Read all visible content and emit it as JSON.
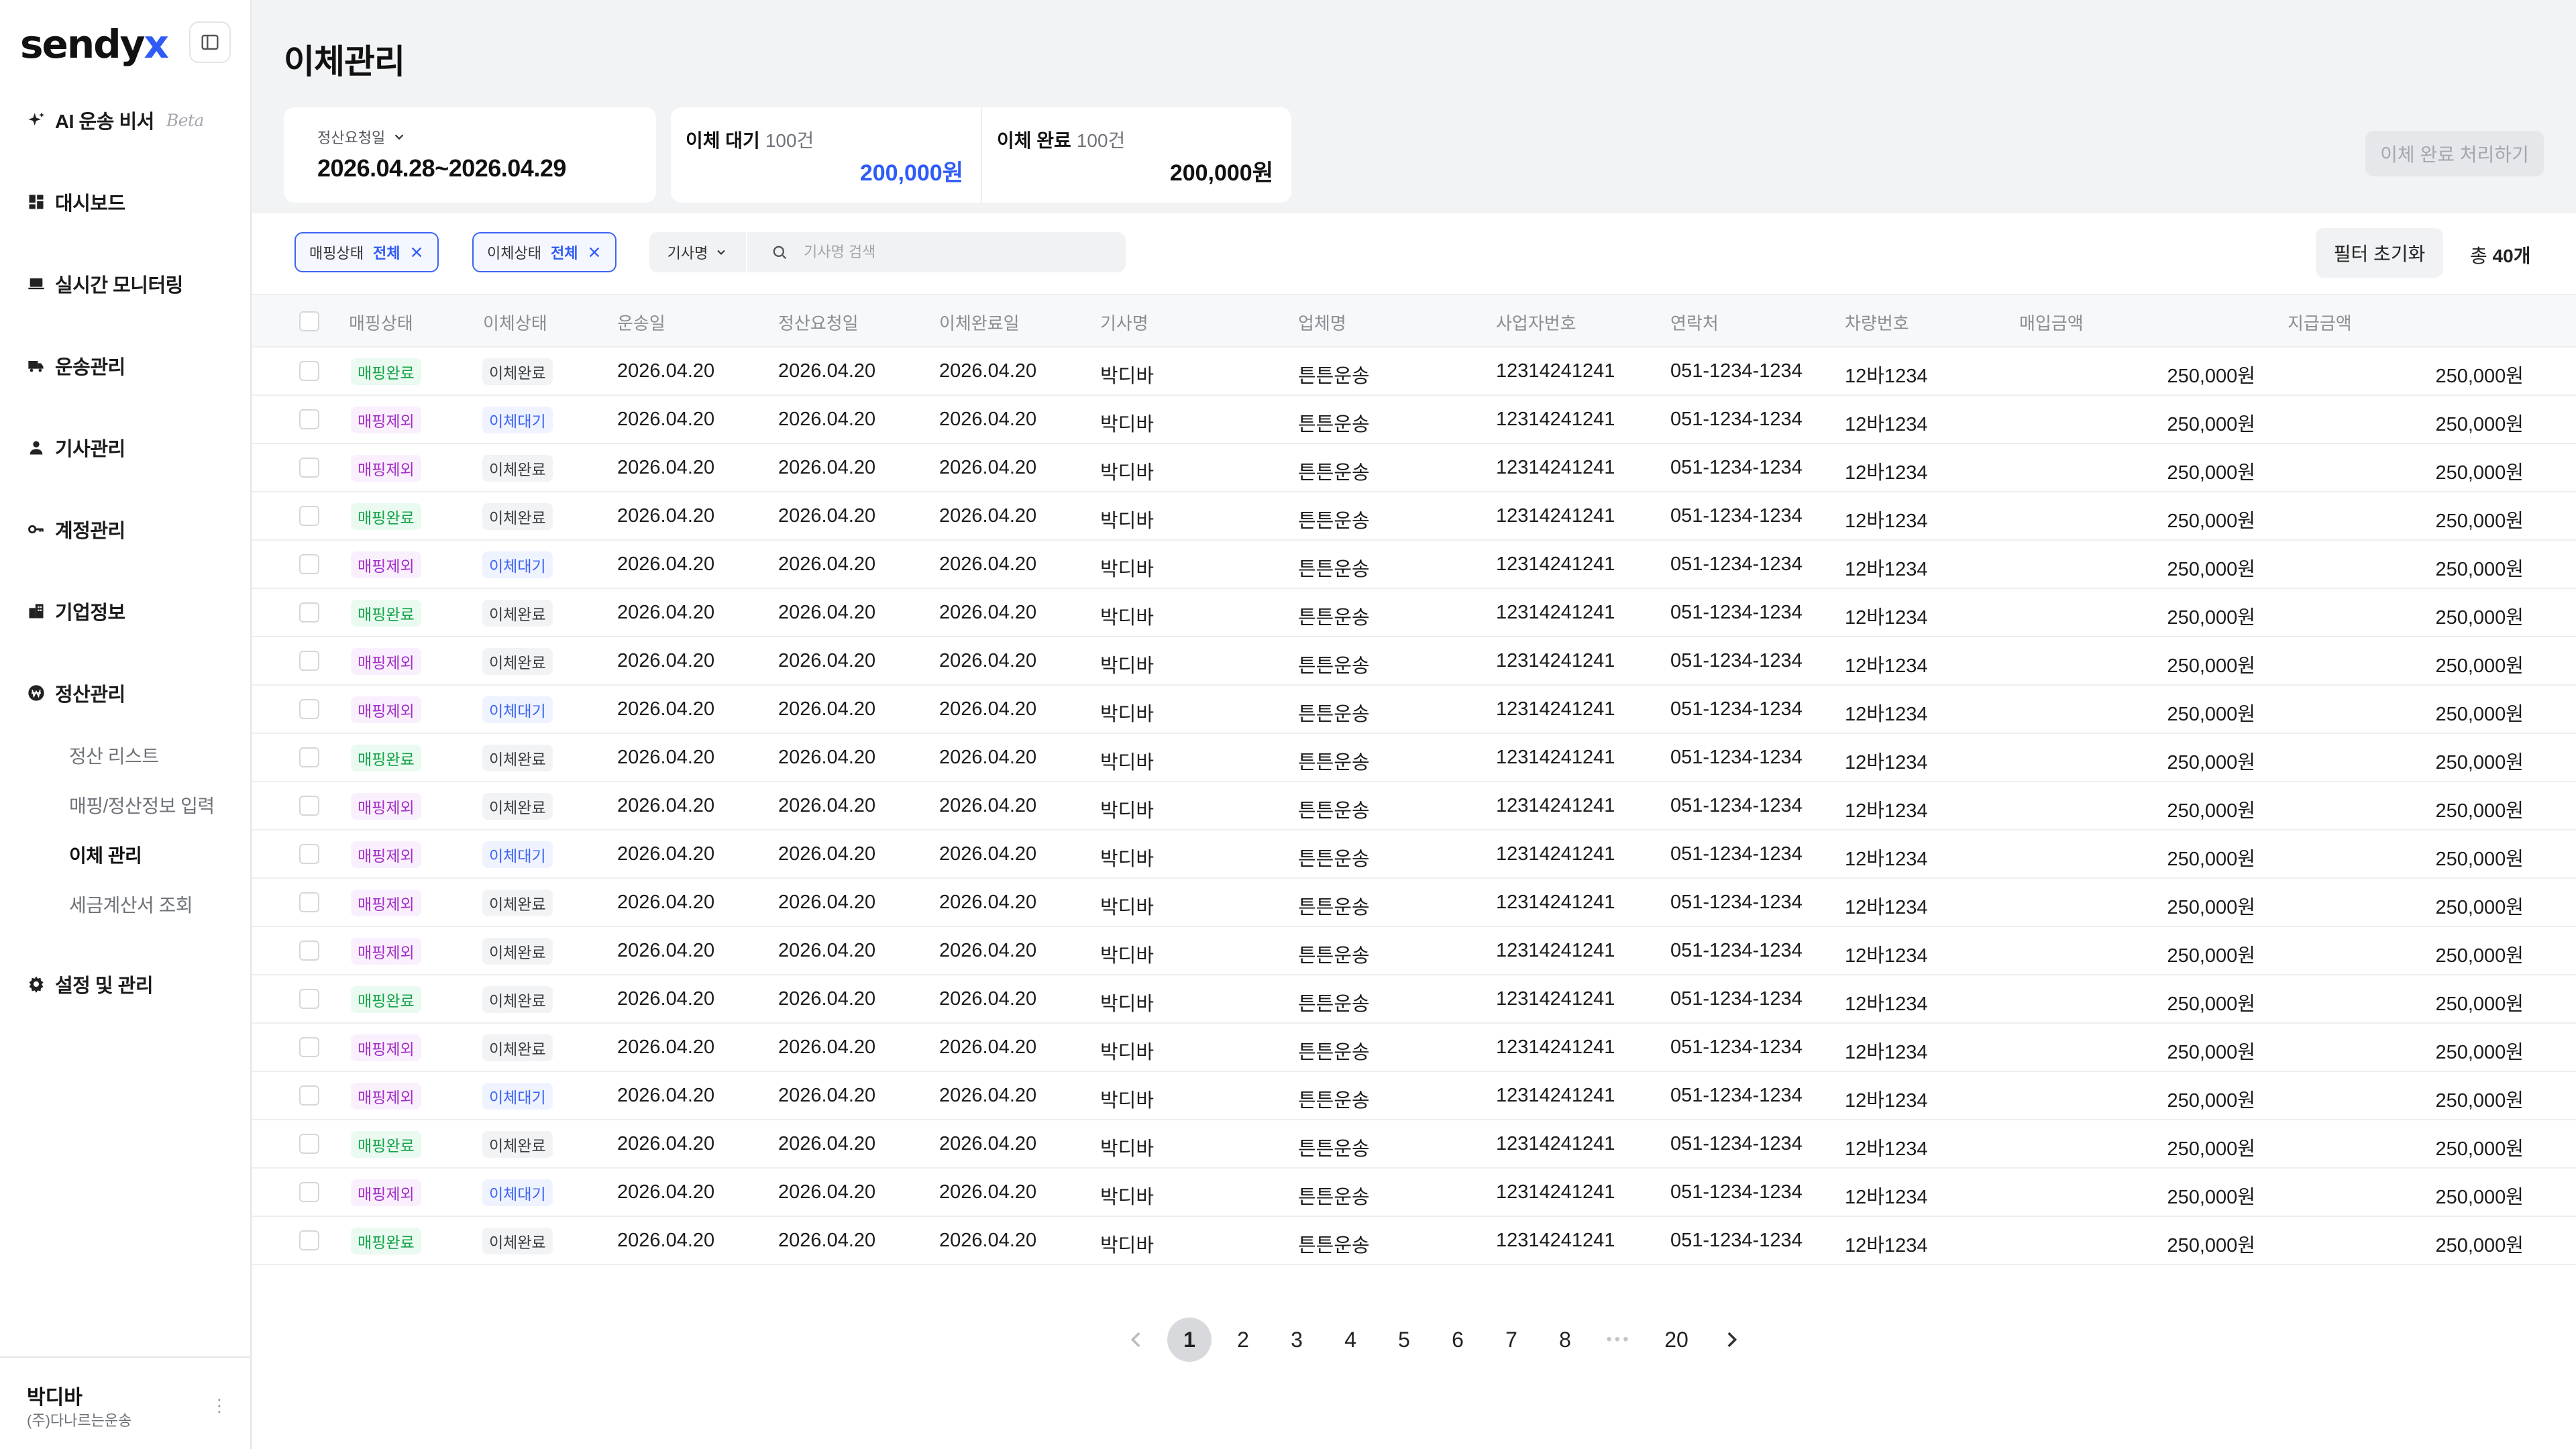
{
  "brand": {
    "name_part1": "sendy",
    "name_part2": "x"
  },
  "sidebar": {
    "items": [
      {
        "label": "AI 운송 비서",
        "badge": "Beta"
      },
      {
        "label": "대시보드"
      },
      {
        "label": "실시간 모니터링"
      },
      {
        "label": "운송관리"
      },
      {
        "label": "기사관리"
      },
      {
        "label": "계정관리"
      },
      {
        "label": "기업정보"
      },
      {
        "label": "정산관리"
      },
      {
        "label": "설정 및 관리"
      }
    ],
    "sub_items": [
      {
        "label": "정산 리스트"
      },
      {
        "label": "매핑/정산정보 입력"
      },
      {
        "label": "이체 관리"
      },
      {
        "label": "세금계산서 조회"
      }
    ],
    "user": {
      "name": "박디바",
      "company": "(주)다나르는운송"
    }
  },
  "page": {
    "title": "이체관리"
  },
  "summary": {
    "date_label": "정산요청일",
    "date_range": "2026.04.28~2026.04.29",
    "pending_label": "이체 대기",
    "pending_count": "100건",
    "pending_amount": "200,000원",
    "done_label": "이체 완료",
    "done_count": "100건",
    "done_amount": "200,000원",
    "action_button": "이체 완료 처리하기"
  },
  "filters": {
    "mapping_label": "매핑상태",
    "mapping_value": "전체",
    "transfer_label": "이체상태",
    "transfer_value": "전체",
    "search_field": "기사명",
    "search_placeholder": "기사명 검색",
    "reset_label": "필터 초기화",
    "total_prefix": "총",
    "total_count": "40개"
  },
  "table": {
    "headers": [
      "매핑상태",
      "이체상태",
      "운송일",
      "정산요청일",
      "이체완료일",
      "기사명",
      "업체명",
      "사업자번호",
      "연락처",
      "차량번호",
      "매입금액",
      "지급금액"
    ],
    "rows": [
      [
        "매핑완료",
        "이체완료",
        "2026.04.20",
        "2026.04.20",
        "2026.04.20",
        "박디바",
        "튼튼운송",
        "12314241241",
        "051-1234-1234",
        "12바1234",
        "250,000원",
        "250,000원"
      ],
      [
        "매핑제외",
        "이체대기",
        "2026.04.20",
        "2026.04.20",
        "2026.04.20",
        "박디바",
        "튼튼운송",
        "12314241241",
        "051-1234-1234",
        "12바1234",
        "250,000원",
        "250,000원"
      ],
      [
        "매핑제외",
        "이체완료",
        "2026.04.20",
        "2026.04.20",
        "2026.04.20",
        "박디바",
        "튼튼운송",
        "12314241241",
        "051-1234-1234",
        "12바1234",
        "250,000원",
        "250,000원"
      ],
      [
        "매핑완료",
        "이체완료",
        "2026.04.20",
        "2026.04.20",
        "2026.04.20",
        "박디바",
        "튼튼운송",
        "12314241241",
        "051-1234-1234",
        "12바1234",
        "250,000원",
        "250,000원"
      ],
      [
        "매핑제외",
        "이체대기",
        "2026.04.20",
        "2026.04.20",
        "2026.04.20",
        "박디바",
        "튼튼운송",
        "12314241241",
        "051-1234-1234",
        "12바1234",
        "250,000원",
        "250,000원"
      ],
      [
        "매핑완료",
        "이체완료",
        "2026.04.20",
        "2026.04.20",
        "2026.04.20",
        "박디바",
        "튼튼운송",
        "12314241241",
        "051-1234-1234",
        "12바1234",
        "250,000원",
        "250,000원"
      ],
      [
        "매핑제외",
        "이체완료",
        "2026.04.20",
        "2026.04.20",
        "2026.04.20",
        "박디바",
        "튼튼운송",
        "12314241241",
        "051-1234-1234",
        "12바1234",
        "250,000원",
        "250,000원"
      ],
      [
        "매핑제외",
        "이체대기",
        "2026.04.20",
        "2026.04.20",
        "2026.04.20",
        "박디바",
        "튼튼운송",
        "12314241241",
        "051-1234-1234",
        "12바1234",
        "250,000원",
        "250,000원"
      ],
      [
        "매핑완료",
        "이체완료",
        "2026.04.20",
        "2026.04.20",
        "2026.04.20",
        "박디바",
        "튼튼운송",
        "12314241241",
        "051-1234-1234",
        "12바1234",
        "250,000원",
        "250,000원"
      ],
      [
        "매핑제외",
        "이체완료",
        "2026.04.20",
        "2026.04.20",
        "2026.04.20",
        "박디바",
        "튼튼운송",
        "12314241241",
        "051-1234-1234",
        "12바1234",
        "250,000원",
        "250,000원"
      ],
      [
        "매핑제외",
        "이체대기",
        "2026.04.20",
        "2026.04.20",
        "2026.04.20",
        "박디바",
        "튼튼운송",
        "12314241241",
        "051-1234-1234",
        "12바1234",
        "250,000원",
        "250,000원"
      ],
      [
        "매핑제외",
        "이체완료",
        "2026.04.20",
        "2026.04.20",
        "2026.04.20",
        "박디바",
        "튼튼운송",
        "12314241241",
        "051-1234-1234",
        "12바1234",
        "250,000원",
        "250,000원"
      ],
      [
        "매핑제외",
        "이체완료",
        "2026.04.20",
        "2026.04.20",
        "2026.04.20",
        "박디바",
        "튼튼운송",
        "12314241241",
        "051-1234-1234",
        "12바1234",
        "250,000원",
        "250,000원"
      ],
      [
        "매핑완료",
        "이체완료",
        "2026.04.20",
        "2026.04.20",
        "2026.04.20",
        "박디바",
        "튼튼운송",
        "12314241241",
        "051-1234-1234",
        "12바1234",
        "250,000원",
        "250,000원"
      ],
      [
        "매핑제외",
        "이체완료",
        "2026.04.20",
        "2026.04.20",
        "2026.04.20",
        "박디바",
        "튼튼운송",
        "12314241241",
        "051-1234-1234",
        "12바1234",
        "250,000원",
        "250,000원"
      ],
      [
        "매핑제외",
        "이체대기",
        "2026.04.20",
        "2026.04.20",
        "2026.04.20",
        "박디바",
        "튼튼운송",
        "12314241241",
        "051-1234-1234",
        "12바1234",
        "250,000원",
        "250,000원"
      ],
      [
        "매핑완료",
        "이체완료",
        "2026.04.20",
        "2026.04.20",
        "2026.04.20",
        "박디바",
        "튼튼운송",
        "12314241241",
        "051-1234-1234",
        "12바1234",
        "250,000원",
        "250,000원"
      ],
      [
        "매핑제외",
        "이체대기",
        "2026.04.20",
        "2026.04.20",
        "2026.04.20",
        "박디바",
        "튼튼운송",
        "12314241241",
        "051-1234-1234",
        "12바1234",
        "250,000원",
        "250,000원"
      ],
      [
        "매핑완료",
        "이체완료",
        "2026.04.20",
        "2026.04.20",
        "2026.04.20",
        "박디바",
        "튼튼운송",
        "12314241241",
        "051-1234-1234",
        "12바1234",
        "250,000원",
        "250,000원"
      ]
    ]
  },
  "pagination": {
    "pages": [
      "1",
      "2",
      "3",
      "4",
      "5",
      "6",
      "7",
      "8",
      "•••",
      "20"
    ],
    "current": "1"
  },
  "colors": {
    "accent": "#2f5bf6",
    "mapping_done": "#15a34a",
    "mapping_excluded": "#a230c7",
    "transfer_waiting": "#3b64f5"
  }
}
